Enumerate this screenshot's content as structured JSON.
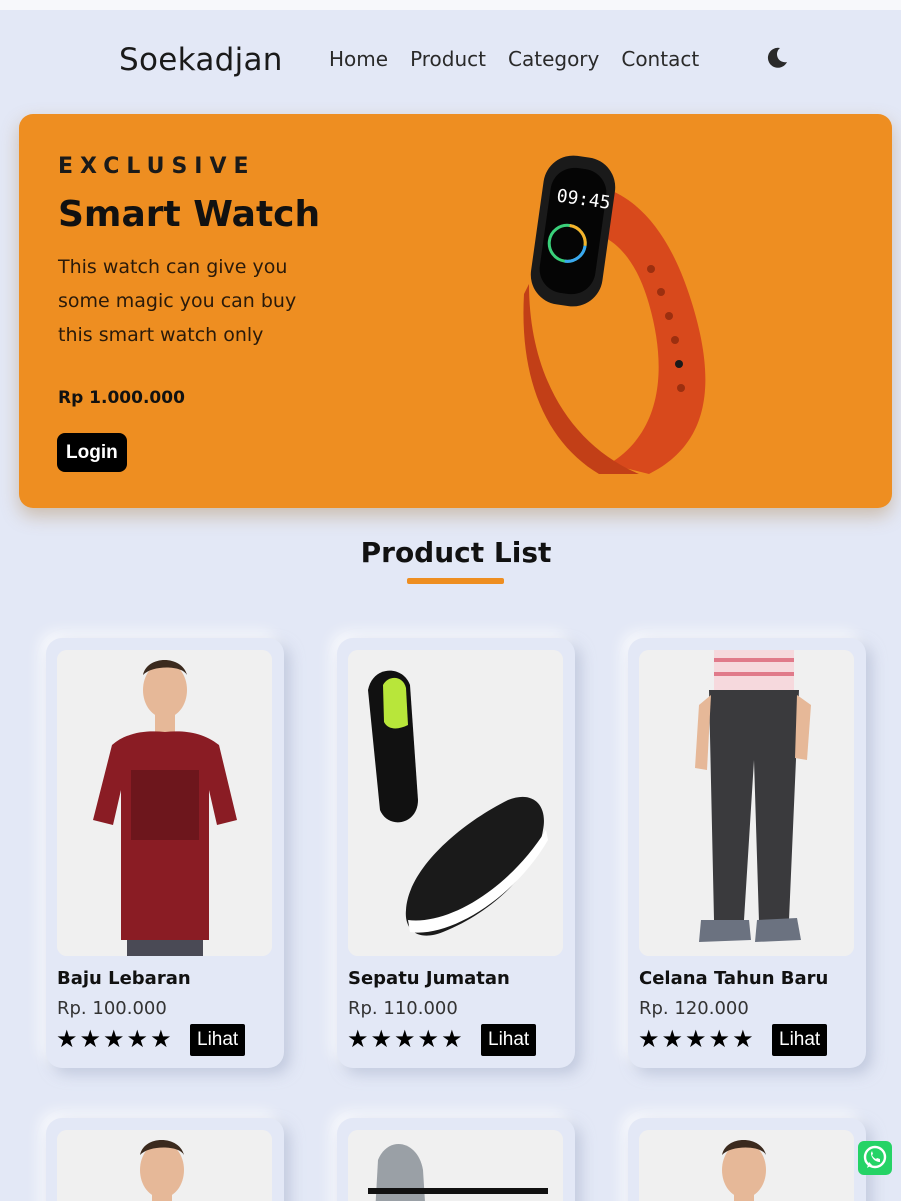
{
  "nav": {
    "brand": "Soekadjan",
    "links": [
      "Home",
      "Product",
      "Category",
      "Contact"
    ],
    "theme_icon": "moon-icon"
  },
  "hero": {
    "kicker": "EXCLUSIVE",
    "title": "Smart Watch",
    "description": "This watch can give you some magic you can buy this smart watch only",
    "price": "Rp 1.000.000",
    "button": "Login",
    "background": "#ee8e21"
  },
  "section": {
    "title": "Product List",
    "accent": "#ee8e21"
  },
  "products": [
    {
      "name": "Baju Lebaran",
      "price": "Rp. 100.000",
      "rating": 5,
      "button": "Lihat",
      "image": "red-tshirt"
    },
    {
      "name": "Sepatu Jumatan",
      "price": "Rp. 110.000",
      "rating": 5,
      "button": "Lihat",
      "image": "black-sneakers"
    },
    {
      "name": "Celana Tahun Baru",
      "price": "Rp. 120.000",
      "rating": 5,
      "button": "Lihat",
      "image": "grey-joggers"
    }
  ],
  "floating": {
    "whatsapp_icon": "whatsapp-icon"
  }
}
